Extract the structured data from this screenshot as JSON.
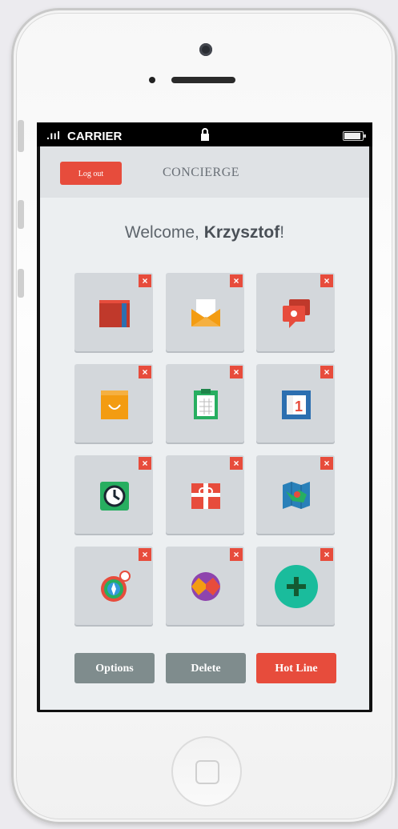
{
  "status": {
    "signal": ".ııl",
    "carrier": "CARRIER"
  },
  "navbar": {
    "logout_label": "Log out",
    "title": "CONCIERGE"
  },
  "welcome": {
    "prefix": "Welcome, ",
    "name": "Krzysztof",
    "suffix": "!"
  },
  "tiles": [
    {
      "icon": "book-icon",
      "remove": "×"
    },
    {
      "icon": "mail-icon",
      "remove": "×"
    },
    {
      "icon": "chat-bird-icon",
      "remove": "×"
    },
    {
      "icon": "shopping-bag-icon",
      "remove": "×"
    },
    {
      "icon": "clipboard-icon",
      "remove": "×"
    },
    {
      "icon": "calendar-icon",
      "remove": "×",
      "day": "1"
    },
    {
      "icon": "clock-icon",
      "remove": "×"
    },
    {
      "icon": "gift-icon",
      "remove": "×"
    },
    {
      "icon": "map-icon",
      "remove": "×"
    },
    {
      "icon": "compass-icon",
      "remove": "×"
    },
    {
      "icon": "globe-icon",
      "remove": "×"
    },
    {
      "icon": "add-icon",
      "remove": "×"
    }
  ],
  "buttons": {
    "options": "Options",
    "delete": "Delete",
    "hotline": "Hot Line"
  },
  "colors": {
    "accent_red": "#e74c3c",
    "button_gray": "#7f8c8d",
    "tile_bg": "#d3d7db"
  }
}
